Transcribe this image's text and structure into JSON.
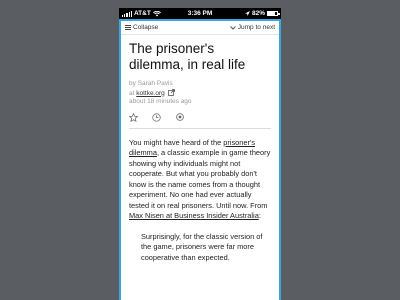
{
  "status_bar": {
    "carrier": "AT&T",
    "time": "3:36 PM",
    "battery_percent": "82%",
    "battery_level": 0.82
  },
  "toolbar": {
    "collapse_label": "Collapse",
    "jump_label": "Jump to next"
  },
  "article": {
    "title": "The prisoner's dilemma, in real life",
    "byline": "by Sarah Pavis",
    "at_prefix": "at",
    "source": "kottke.org",
    "time_ago": "about 18 minutes ago",
    "body": {
      "p1": "You might have heard of the ",
      "link1": "prisoner's dilemma",
      "p2": ", a classic example in game theory showing why individuals might not cooperate. But what you probably don't know is the name comes from a thought experiment. No one had ever actually tested it on real prisoners. Until now. From ",
      "link2": "Max Nisen at Business Insider Australia",
      "p3": ":"
    },
    "quote": "Surprisingly, for the classic version of the game, prisoners were far more cooperative than expected."
  },
  "icons": {
    "menu": "hamburger-icon",
    "jump": "chevron-down-icon",
    "external": "external-link-icon",
    "star": "star-icon",
    "clock": "clock-icon",
    "eye": "eye-icon"
  },
  "colors": {
    "accent_border": "#37a8e0",
    "background": "#5a5e63"
  }
}
